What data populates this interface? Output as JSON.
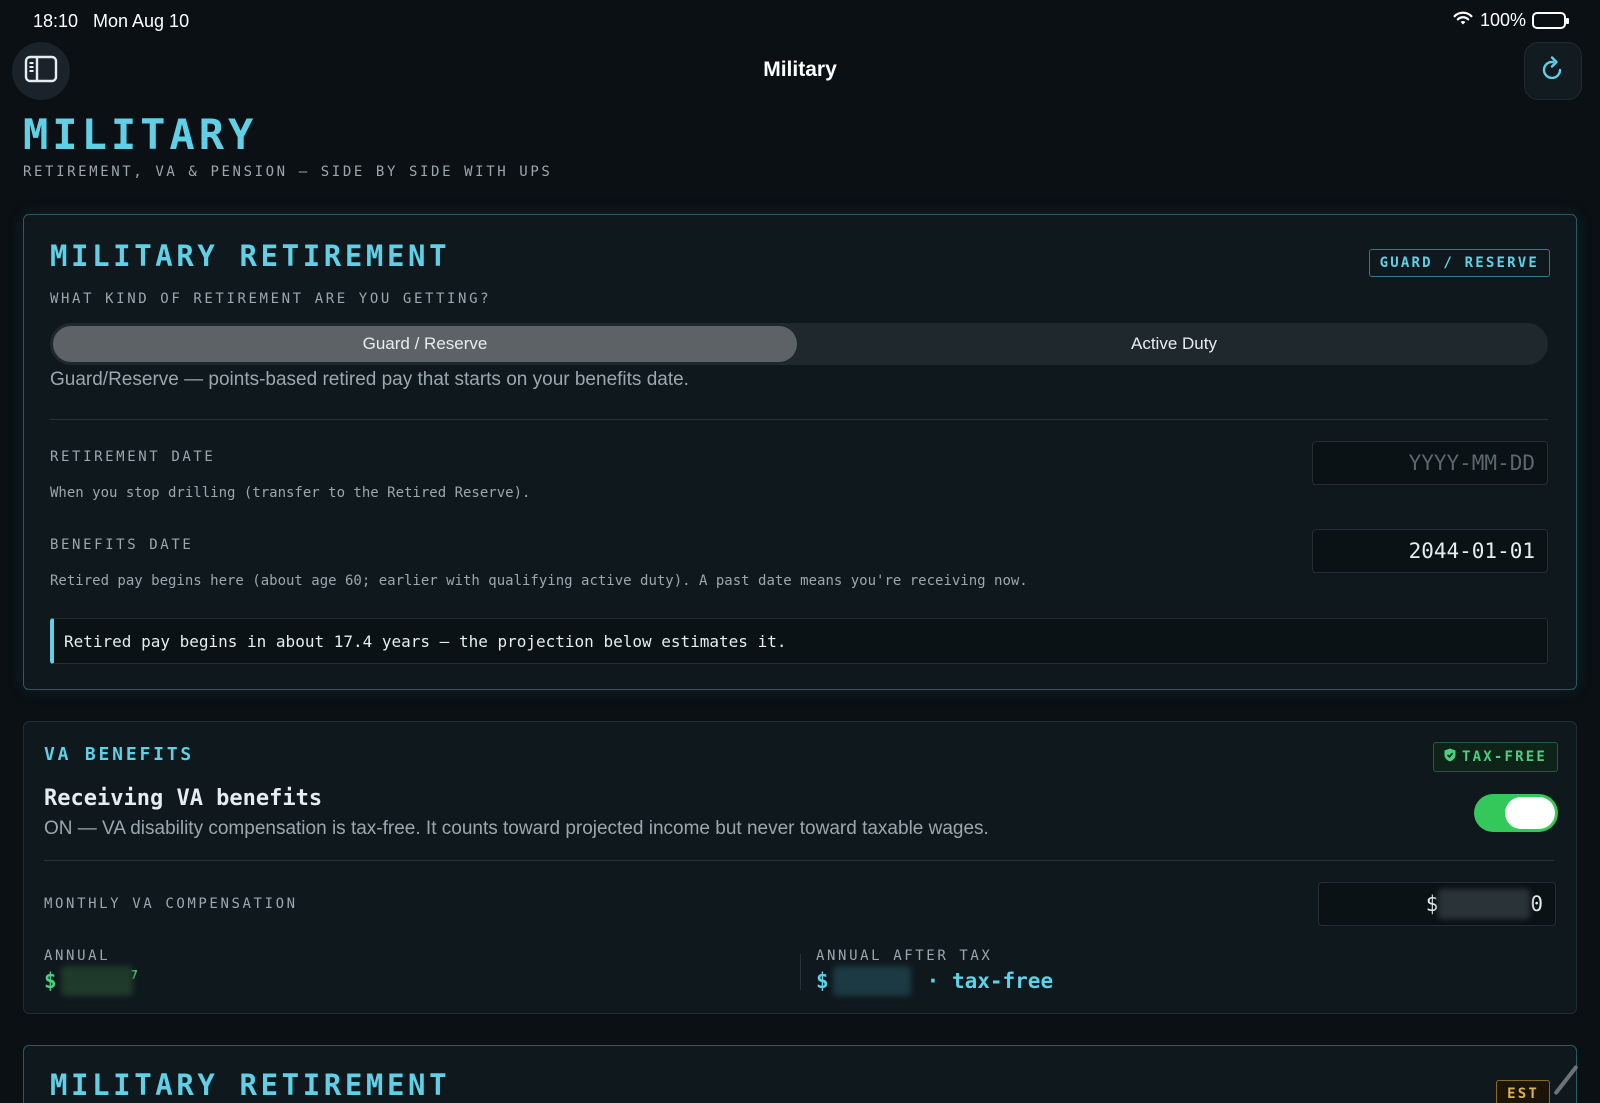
{
  "status_bar": {
    "time": "18:10",
    "date": "Mon Aug 10",
    "battery": "100%"
  },
  "nav": {
    "title": "Military"
  },
  "page": {
    "title": "MILITARY",
    "subtitle": "RETIREMENT, VA & PENSION — SIDE BY SIDE WITH UPS"
  },
  "retirement_card": {
    "title": "MILITARY RETIREMENT",
    "badge": "GUARD / RESERVE",
    "question": "WHAT KIND OF RETIREMENT ARE YOU GETTING?",
    "options": [
      "Guard / Reserve",
      "Active Duty"
    ],
    "selected": "Guard / Reserve",
    "selected_desc": "Guard/Reserve — points-based retired pay that starts on your benefits date.",
    "retirement_date": {
      "label": "RETIREMENT DATE",
      "help": "When you stop drilling (transfer to the Retired Reserve).",
      "placeholder": "YYYY-MM-DD",
      "value": ""
    },
    "benefits_date": {
      "label": "BENEFITS DATE",
      "help": "Retired pay begins here (about age 60; earlier with qualifying active duty). A past date means you're receiving now.",
      "value": "2044-01-01"
    },
    "callout": "Retired pay begins in about 17.4 years — the projection below estimates it."
  },
  "va_card": {
    "title": "VA BENEFITS",
    "badge": "TAX-FREE",
    "heading": "Receiving VA benefits",
    "desc": "ON — VA disability compensation is tax-free. It counts toward projected income but never toward taxable wages.",
    "toggle_on": true,
    "monthly_label": "MONTHLY VA COMPENSATION",
    "monthly_prefix": "$",
    "monthly_visible_suffix": "0",
    "annual_label": "ANNUAL",
    "annual_prefix": "$",
    "annual_visible_suffix": "7",
    "after_tax_label": "ANNUAL AFTER TAX",
    "after_tax_prefix": "$",
    "after_tax_suffix": "· tax-free"
  },
  "projection_card": {
    "title": "MILITARY RETIREMENT",
    "badge": "EST"
  },
  "colors": {
    "accent": "#5fd0e6",
    "success": "#4ccf7f",
    "background": "#0a1014",
    "toggle_on": "#34c759"
  },
  "icons": {
    "sidebar": "sidebar-toggle-icon",
    "refresh": "refresh-icon",
    "wifi": "wifi-icon",
    "battery": "battery-icon",
    "shield": "shield-icon"
  }
}
